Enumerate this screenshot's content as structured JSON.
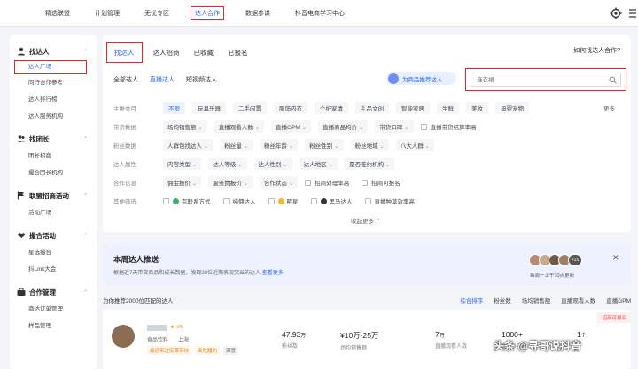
{
  "topnav": [
    "精选联盟",
    "计划管理",
    "无忧专区",
    "达人合作",
    "数据参谋",
    "抖音电商学习中心"
  ],
  "topnav_active": "达人合作",
  "sidebar": [
    {
      "title": "找达人",
      "items": [
        "达人广场",
        "同行合作参考",
        "达人排行榜",
        "达人服务机构"
      ]
    },
    {
      "title": "找团长",
      "items": [
        "团长招商",
        "撮合团长机构"
      ]
    },
    {
      "title": "联盟招商活动",
      "items": [
        "活动广场"
      ]
    },
    {
      "title": "撮合活动",
      "items": [
        "星选撮合",
        "抖Link大会"
      ]
    },
    {
      "title": "合作管理",
      "items": [
        "商达订单管理",
        "样品管理"
      ]
    }
  ],
  "sidebar_active": "达人广场",
  "tabs": [
    "找达人",
    "达人招商",
    "已收藏",
    "已报名"
  ],
  "help_link": "如何找达人合作?",
  "subtabs": [
    "全部达人",
    "直播达人",
    "短视频达人"
  ],
  "recommend_button": "为商品推荐达人",
  "search": {
    "placeholder": "连衣裙",
    "value": ""
  },
  "filters": {
    "category": {
      "label": "主推类目",
      "options": [
        "不限",
        "玩具乐器",
        "二手闲置",
        "服饰内衣",
        "个护家清",
        "礼品文创",
        "智能家居",
        "生鲜",
        "美妆",
        "母婴宠物"
      ],
      "selected": "不限",
      "more": "更多"
    },
    "sales": {
      "label": "带货数据",
      "dropdowns": [
        "场均销售额",
        "直播观看人数",
        "直播GPM",
        "直播商品均价",
        "带货口碑"
      ],
      "checkbox": "直播带货结算率高"
    },
    "fans": {
      "label": "粉丝数据",
      "dropdowns": [
        "人群包找达人",
        "粉丝量",
        "粉丝年龄",
        "粉丝性别",
        "粉丝地域",
        "八大人群"
      ]
    },
    "attr": {
      "label": "达人属性",
      "dropdowns": [
        "内容类型",
        "达人等级",
        "达人性别",
        "达人地区",
        "是否签约机构"
      ]
    },
    "coop": {
      "label": "合作信息",
      "dropdowns": [
        "佣金报价",
        "服务费报价",
        "合作状态"
      ],
      "checkboxes": [
        "招商处理率高",
        "招商可报名"
      ]
    },
    "other": {
      "label": "其他筛选",
      "checkboxes": [
        "有联系方式",
        "纯佣达人",
        "明星",
        "黑马达人",
        "直播种草效率高"
      ]
    }
  },
  "collapse_more": "收起更多",
  "weekly": {
    "title": "本周达人推送",
    "subtitle": "根据近7天带货商品和成长数据，发现20位近期表现突出的达人",
    "link": "查看更多",
    "update": "每周一上午10点更新",
    "count": "+15"
  },
  "results": {
    "count_text": "为你推荐2000位匹配的达人",
    "sorts": [
      "综合排序",
      "粉丝数",
      "场均销售额",
      "直播观看人数",
      "直播GPM"
    ],
    "active_sort": "综合排序"
  },
  "card": {
    "badge": "招商可报名",
    "level": "★LV5",
    "category": "食品饮料",
    "location": "上海",
    "tags": [
      "最近带过宋腰带袜",
      "高效履约",
      "满意"
    ],
    "metrics": [
      {
        "value": "47.93",
        "unit": "万",
        "label": "粉丝数"
      },
      {
        "value": "¥10万-25万",
        "unit": "",
        "label": "场均销售额"
      },
      {
        "value": "7",
        "unit": "万",
        "label": "直播观看人数"
      },
      {
        "value": "1000+",
        "unit": "",
        "label": "直播GPM"
      },
      {
        "value": "1",
        "unit": "个",
        "label": ""
      }
    ]
  },
  "watermark": "头条 @寻哥说抖音",
  "colors": {
    "accent": "#2b63f5",
    "highlight_border": "#e02828"
  }
}
